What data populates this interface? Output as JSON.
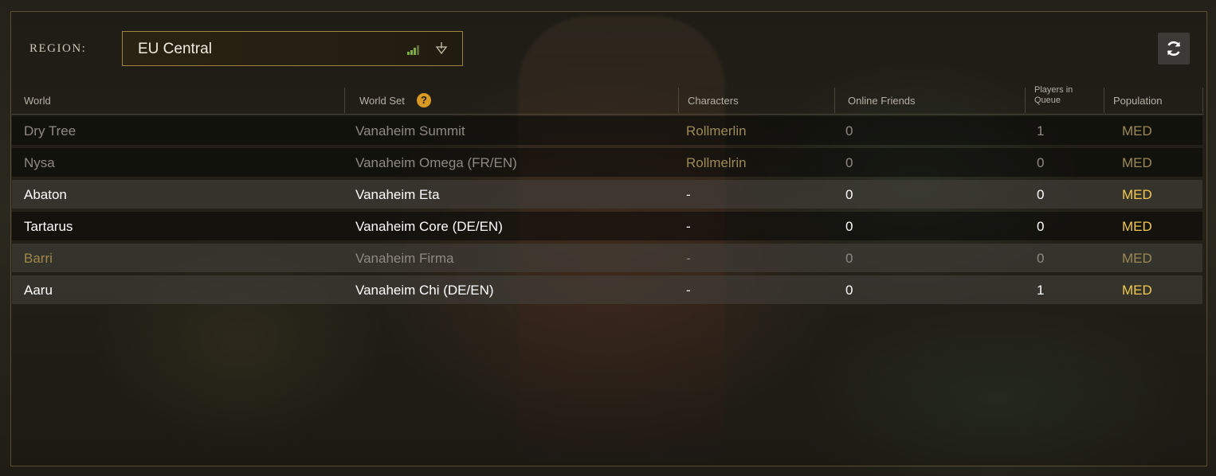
{
  "region": {
    "label": "REGION:",
    "selected": "EU Central",
    "signal_icon": "signal-bars-icon",
    "dropdown_icon": "chevron-down-icon"
  },
  "refresh_icon": "refresh-icon",
  "table": {
    "headers": {
      "world": "World",
      "world_set": "World Set",
      "characters": "Characters",
      "online_friends": "Online Friends",
      "players_in_queue_1": "Players in",
      "players_in_queue_2": "Queue",
      "population": "Population"
    },
    "help_icon": "?",
    "rows": [
      {
        "world": "Dry Tree",
        "world_set": "Vanaheim Summit",
        "characters": "Rollmerlin",
        "online_friends": "0",
        "queue": "1",
        "population": "MED"
      },
      {
        "world": "Nysa",
        "world_set": "Vanaheim Omega (FR/EN)",
        "characters": "Rollmelrin",
        "online_friends": "0",
        "queue": "0",
        "population": "MED"
      },
      {
        "world": "Abaton",
        "world_set": "Vanaheim Eta",
        "characters": "-",
        "online_friends": "0",
        "queue": "0",
        "population": "MED"
      },
      {
        "world": "Tartarus",
        "world_set": "Vanaheim Core (DE/EN)",
        "characters": "-",
        "online_friends": "0",
        "queue": "0",
        "population": "MED"
      },
      {
        "world": "Barri",
        "world_set": "Vanaheim Firma",
        "characters": "-",
        "online_friends": "0",
        "queue": "0",
        "population": "MED"
      },
      {
        "world": "Aaru",
        "world_set": "Vanaheim Chi (DE/EN)",
        "characters": "-",
        "online_friends": "0",
        "queue": "1",
        "population": "MED"
      }
    ]
  },
  "colors": {
    "accent_gold": "#f2c94f",
    "border_gold": "#a0843f",
    "signal_green": "#7fae3a",
    "help_orange": "#d89a23"
  }
}
